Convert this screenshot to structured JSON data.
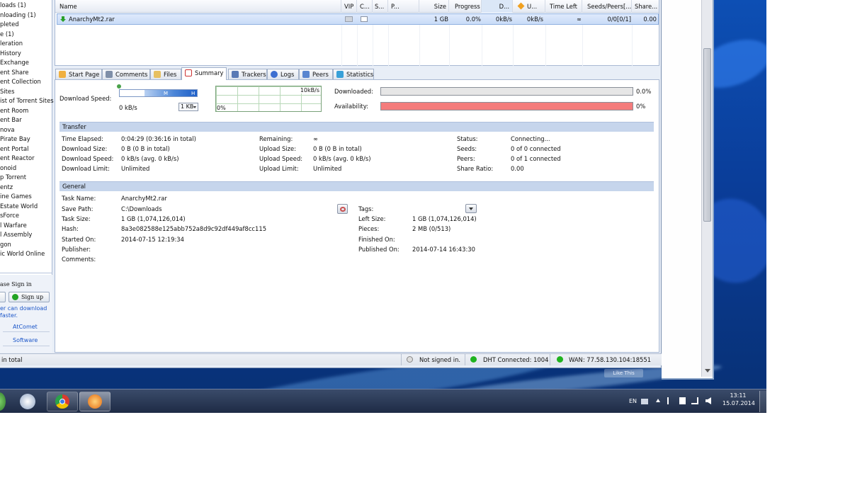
{
  "sidebar": {
    "items": [
      "loads (1)",
      "nloading (1)",
      "pleted",
      "e (1)",
      "leration",
      "History",
      "Exchange",
      "ent Share",
      "ent Collection",
      "Sites",
      "ist of Torrent Sites",
      "ent Room",
      "ent Bar",
      "nova",
      "Pirate Bay",
      "ent Portal",
      "ent Reactor",
      "onoid",
      "p Torrent",
      "entz",
      "ine Games",
      "Estate World",
      "sForce",
      "l Warfare",
      "l Assembly",
      "gon",
      "ic World Online"
    ],
    "signin_prompt": "ase Sign in",
    "signup_label": "Sign up",
    "promo_line1": "er can download",
    "promo_line2": "faster.",
    "link1": "AtComet",
    "link2": "Software",
    "footer": "in total"
  },
  "list": {
    "columns": [
      "Name",
      "VIP",
      "C...",
      "S...",
      "P...",
      "Size",
      "Progress",
      "D...",
      "U...",
      "Time Left",
      "Seeds/Peers[...",
      "Share..."
    ],
    "rows": [
      {
        "name": "AnarchyMt2.rar",
        "size": "1 GB",
        "progress": "0.0%",
        "down": "0kB/s",
        "up": "0kB/s",
        "time_left": "∞",
        "seeds": "0/0[0/1]",
        "share": "0.00"
      }
    ]
  },
  "tabs": [
    "Start Page",
    "Comments",
    "Files",
    "Summary",
    "Trackers",
    "Logs",
    "Peers",
    "Statistics"
  ],
  "summary": {
    "speed_label": "Download Speed:",
    "speed_value": "0 kB/s",
    "speed_limit": "1 KB",
    "slider_m": "M",
    "slider_h": "H",
    "graph_max": "10kB/s",
    "graph_min": "0%",
    "downloaded_label": "Downloaded:",
    "downloaded_value": "0.0%",
    "downloaded_fraction": 0.0,
    "availability_label": "Availability:",
    "availability_value": "0%",
    "availability_fraction": 1.0,
    "transfer_title": "Transfer",
    "transfer": {
      "time_elapsed_label": "Time Elapsed:",
      "time_elapsed": "0:04:29 (0:36:16 in total)",
      "download_size_label": "Download Size:",
      "download_size": "0 B (0 B in total)",
      "download_speed_label": "Download Speed:",
      "download_speed": "0 kB/s (avg. 0 kB/s)",
      "download_limit_label": "Download Limit:",
      "download_limit": "Unlimited",
      "remaining_label": "Remaining:",
      "remaining": "∞",
      "upload_size_label": "Upload Size:",
      "upload_size": "0 B (0 B in total)",
      "upload_speed_label": "Upload Speed:",
      "upload_speed": "0 kB/s (avg. 0 kB/s)",
      "upload_limit_label": "Upload Limit:",
      "upload_limit": "Unlimited",
      "status_label": "Status:",
      "status": "Connecting...",
      "seeds_label": "Seeds:",
      "seeds": "0 of 0 connected",
      "peers_label": "Peers:",
      "peers": "0 of 1 connected",
      "share_ratio_label": "Share Ratio:",
      "share_ratio": "0.00"
    },
    "general_title": "General",
    "general": {
      "task_name_label": "Task Name:",
      "task_name": "AnarchyMt2.rar",
      "save_path_label": "Save Path:",
      "save_path": "C:\\Downloads",
      "task_size_label": "Task Size:",
      "task_size": "1 GB (1,074,126,014)",
      "hash_label": "Hash:",
      "hash": "8a3e082588e125abb752a8d9c92df449af8cc115",
      "started_on_label": "Started On:",
      "started_on": "2014-07-15 12:19:34",
      "publisher_label": "Publisher:",
      "comments_label": "Comments:",
      "tags_label": "Tags:",
      "left_size_label": "Left Size:",
      "left_size": "1 GB (1,074,126,014)",
      "pieces_label": "Pieces:",
      "pieces": "2 MB (0/513)",
      "finished_on_label": "Finished On:",
      "published_on_label": "Published On:",
      "published_on": "2014-07-14 16:43:30"
    }
  },
  "status": {
    "signin": "Not signed in.",
    "dht": "DHT Connected: 1004",
    "wan": "WAN: 77.58.130.104:18551"
  },
  "background": {
    "like_label": "Like This"
  },
  "taskbar": {
    "lang": "EN",
    "time": "13:11",
    "date": "15.07.2014"
  },
  "colors": {
    "accent": "#c6d5ec",
    "availability": "#f47c7c",
    "status_green": "#1fb31f"
  }
}
